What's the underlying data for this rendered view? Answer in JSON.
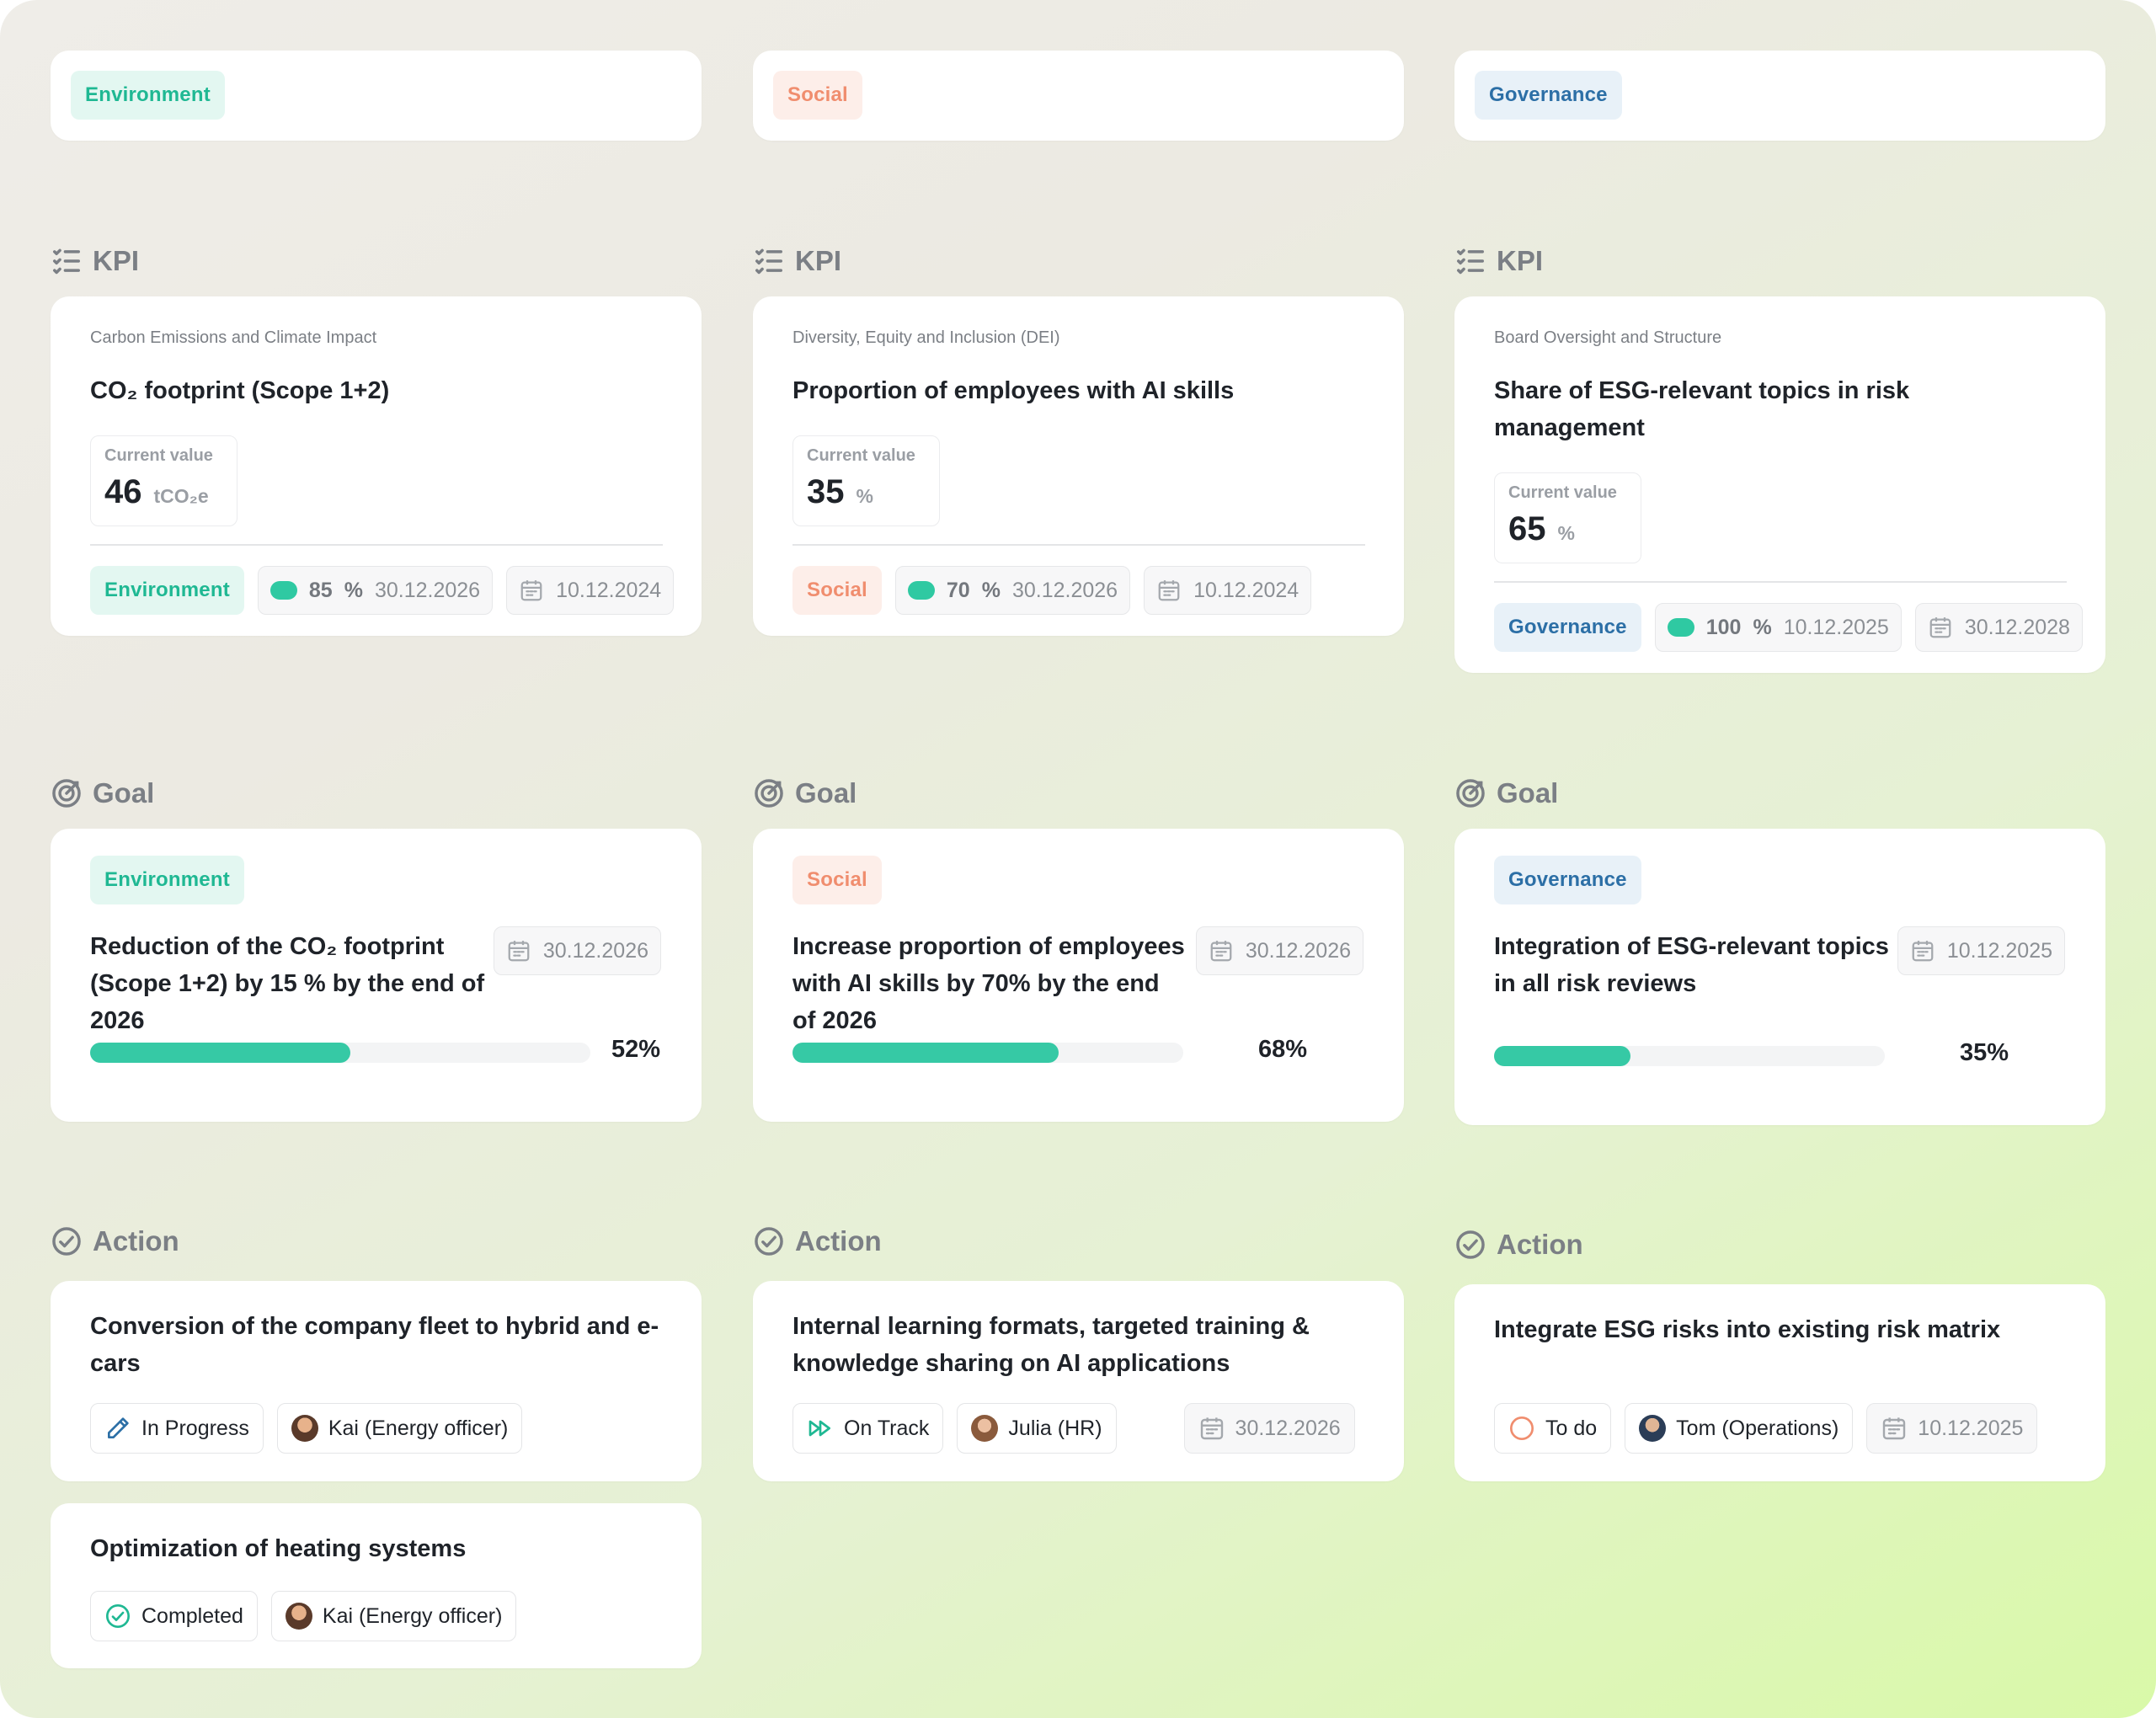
{
  "columns": [
    {
      "pillar": "Environment",
      "kpi_section": "KPI",
      "goal_section": "Goal",
      "action_section": "Action",
      "kpi": {
        "category": "Carbon Emissions and Climate Impact",
        "title": "CO₂ footprint (Scope 1+2)",
        "current_label": "Current value",
        "current_value": "46",
        "current_unit": "tCO₂e",
        "tag": "Environment",
        "target_percent": "85",
        "percent_sign": "%",
        "target_date": "30.12.2026",
        "date": "10.12.2024"
      },
      "goal": {
        "tag": "Environment",
        "title": "Reduction of the CO₂ footprint (Scope 1+2) by 15 % by the end of 2026",
        "date": "30.12.2026",
        "progress": 52,
        "progress_label": "52%"
      },
      "actions": [
        {
          "title": "Conversion of the company fleet to hybrid and e-cars",
          "status": "In Progress",
          "status_icon": "pencil-icon",
          "owner": "Kai (Energy officer)"
        },
        {
          "title": "Optimization of heating systems",
          "status": "Completed",
          "status_icon": "check-circle-icon",
          "owner": "Kai (Energy officer)"
        }
      ]
    },
    {
      "pillar": "Social",
      "kpi_section": "KPI",
      "goal_section": "Goal",
      "action_section": "Action",
      "kpi": {
        "category": "Diversity, Equity and Inclusion (DEI)",
        "title": "Proportion of employees with AI skills",
        "current_label": "Current value",
        "current_value": "35",
        "current_unit": "%",
        "tag": "Social",
        "target_percent": "70",
        "percent_sign": "%",
        "target_date": "30.12.2026",
        "date": "10.12.2024"
      },
      "goal": {
        "tag": "Social",
        "title": "Increase proportion of employees with AI skills by 70% by the end of 2026",
        "date": "30.12.2026",
        "progress": 68,
        "progress_label": "68%"
      },
      "actions": [
        {
          "title": "Internal learning formats, targeted training & knowledge sharing on AI applications",
          "status": "On Track",
          "status_icon": "fast-forward-icon",
          "owner": "Julia (HR)",
          "date": "30.12.2026"
        }
      ]
    },
    {
      "pillar": "Governance",
      "kpi_section": "KPI",
      "goal_section": "Goal",
      "action_section": "Action",
      "kpi": {
        "category": "Board Oversight and Structure",
        "title": "Share of ESG-relevant topics in risk management",
        "current_label": "Current value",
        "current_value": "65",
        "current_unit": "%",
        "tag": "Governance",
        "target_percent": "100",
        "percent_sign": "%",
        "target_date": "10.12.2025",
        "date": "30.12.2028"
      },
      "goal": {
        "tag": "Governance",
        "title": "Integration of ESG-relevant topics in all risk reviews",
        "date": "10.12.2025",
        "progress": 35,
        "progress_label": "35%"
      },
      "actions": [
        {
          "title": "Integrate ESG risks into existing risk matrix",
          "status": "To do",
          "status_icon": "empty-circle-icon",
          "owner": "Tom (Operations)",
          "date": "10.12.2025"
        }
      ]
    }
  ],
  "colors": {
    "environment_text": "#1fb893",
    "environment_bg": "#e3f7f1",
    "social_text": "#f08d6e",
    "social_bg": "#fdeee9",
    "governance_text": "#2c6fa6",
    "governance_bg": "#e8f1f8",
    "progress": "#36c9a5"
  }
}
